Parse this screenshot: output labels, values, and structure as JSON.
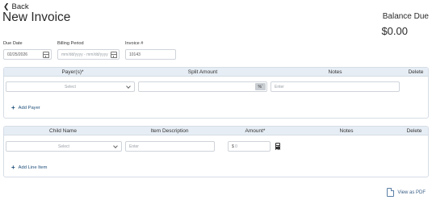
{
  "header": {
    "back_label": "Back",
    "title": "New Invoice",
    "balance_label": "Balance Due",
    "balance_value": "$0.00"
  },
  "fields": {
    "due_date": {
      "label": "Due Date",
      "value": "02/25/2026"
    },
    "billing_period": {
      "label": "Billing Period",
      "placeholder": "mm/dd/yyyy - mm/dd/yyyy"
    },
    "invoice_number": {
      "label": "Invoice #",
      "value": "10143"
    }
  },
  "payers": {
    "columns": [
      "Payer(s)*",
      "Split Amount",
      "Notes",
      "Delete"
    ],
    "row": {
      "payer_placeholder": "Select",
      "split_value": "",
      "split_unit": "%",
      "notes_placeholder": "Enter"
    },
    "add_label": "Add Payer"
  },
  "line_items": {
    "columns": [
      "Child Name",
      "Item Description",
      "Amount*",
      "Notes",
      "Delete"
    ],
    "row": {
      "child_placeholder": "Select",
      "description_placeholder": "Enter",
      "amount_prefix": "$",
      "amount_value": "0"
    },
    "add_label": "Add Line Item"
  },
  "footer": {
    "pdf_label": "View as PDF"
  },
  "icons": {
    "back": "chevron-left-icon",
    "calendar": "calendar-icon",
    "dropdown": "chevron-down-icon",
    "calculator": "calculator-icon",
    "add": "plus-icon",
    "pdf": "document-icon"
  },
  "colors": {
    "table_header_bg": "#e6edf4",
    "link": "#1f4f7a",
    "border": "#d5dde5"
  }
}
